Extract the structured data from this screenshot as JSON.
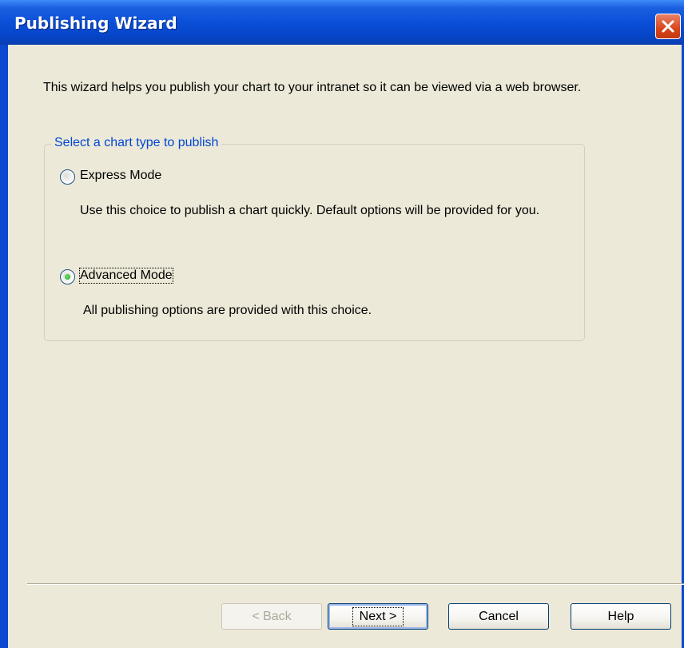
{
  "window": {
    "title": "Publishing Wizard"
  },
  "intro": {
    "text": "This wizard helps you publish your chart to your intranet so it can be viewed via a web browser."
  },
  "group": {
    "legend": "Select a chart type to publish",
    "options": [
      {
        "label": "Express Mode",
        "description": "Use this choice to publish a chart quickly.  Default options will be provided for you.",
        "selected": false
      },
      {
        "label": "Advanced Mode",
        "description": "All publishing options are provided with this choice.",
        "selected": true
      }
    ]
  },
  "buttons": {
    "back": "< Back",
    "next": "Next >",
    "cancel": "Cancel",
    "help": "Help"
  },
  "colors": {
    "title_bar": "#0a4fd8",
    "group_legend": "#0046d5",
    "dialog_bg": "#ece9d8",
    "close_button": "#d9461c"
  },
  "icons": {
    "close": "close-icon"
  }
}
